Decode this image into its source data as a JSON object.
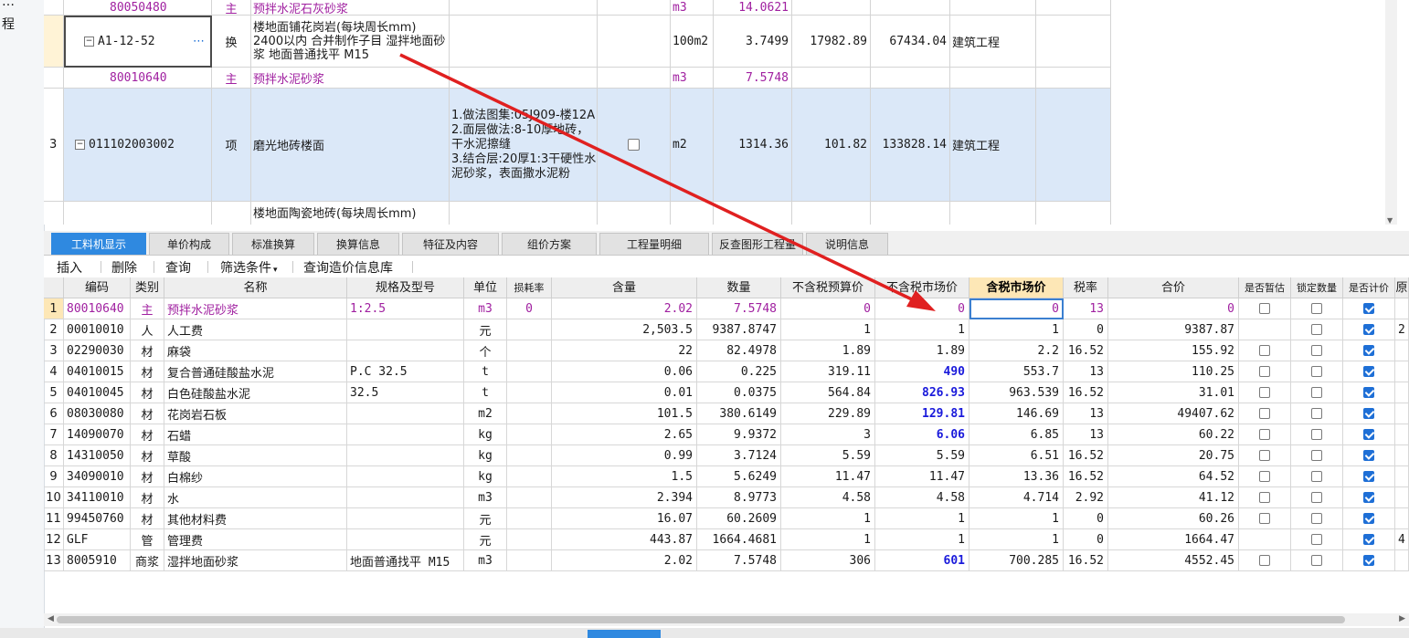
{
  "left_panel": {
    "items": [
      "…",
      "程"
    ]
  },
  "top_grid": {
    "rows": [
      {
        "no": "",
        "code": "80050480",
        "kind": "主",
        "name": "预拌水泥石灰砂浆",
        "desc": "",
        "unit": "m3",
        "qty": "14.0621",
        "price": "",
        "total": "",
        "type": ""
      },
      {
        "no": "",
        "code": "A1-12-52",
        "kind": "换",
        "name": "楼地面铺花岗岩(每块周长mm) 2400以内  合并制作子目 湿拌地面砂浆 地面普通找平 M15",
        "desc": "",
        "unit": "100m2",
        "qty": "3.7499",
        "price": "17982.89",
        "total": "67434.04",
        "type": "建筑工程"
      },
      {
        "no": "",
        "code": "80010640",
        "kind": "主",
        "name": "预拌水泥砂浆",
        "desc": "",
        "unit": "m3",
        "qty": "7.5748",
        "price": "",
        "total": "",
        "type": ""
      },
      {
        "no": "3",
        "code": "011102003002",
        "kind": "项",
        "name": "磨光地砖楼面",
        "desc": "1.做法图集:05J909-楼12A\n2.面层做法:8-10厚地砖，干水泥擦缝\n3.结合层:20厚1:3干硬性水泥砂浆，表面撒水泥粉",
        "unit": "m2",
        "qty": "1314.36",
        "price": "101.82",
        "total": "133828.14",
        "type": "建筑工程"
      },
      {
        "no": "",
        "code": "",
        "kind": "",
        "name": "楼地面陶瓷地砖(每块周长mm)",
        "desc": "",
        "unit": "",
        "qty": "",
        "price": "",
        "total": "",
        "type": ""
      }
    ]
  },
  "tabs": [
    "工料机显示",
    "单价构成",
    "标准换算",
    "换算信息",
    "特征及内容",
    "组价方案",
    "工程量明细",
    "反查图形工程量",
    "说明信息"
  ],
  "active_tab": 0,
  "toolbar": [
    "插入",
    "删除",
    "查询",
    "筛选条件",
    "查询造价信息库"
  ],
  "columns": [
    "编码",
    "类别",
    "名称",
    "规格及型号",
    "单位",
    "损耗率",
    "含量",
    "数量",
    "不含税预算价",
    "不含税市场价",
    "含税市场价",
    "税率",
    "合价",
    "是否暂估",
    "锁定数量",
    "是否计价",
    "原"
  ],
  "rows": [
    {
      "no": "1",
      "code": "80010640",
      "cat": "主",
      "name": "预拌水泥砂浆",
      "spec": "1:2.5",
      "unit": "m3",
      "loss": "0",
      "content": "2.02",
      "qty": "7.5748",
      "budget": "0",
      "market": "0",
      "tax_market": "0",
      "rate": "13",
      "total": "0",
      "est": false,
      "lock": false,
      "priced": true,
      "orig": ""
    },
    {
      "no": "2",
      "code": "00010010",
      "cat": "人",
      "name": "人工费",
      "spec": "",
      "unit": "元",
      "loss": "",
      "content": "2,503.5",
      "qty": "9387.8747",
      "budget": "1",
      "market": "1",
      "tax_market": "1",
      "rate": "0",
      "total": "9387.87",
      "est": null,
      "lock": false,
      "priced": true,
      "orig": "2"
    },
    {
      "no": "3",
      "code": "02290030",
      "cat": "材",
      "name": "麻袋",
      "spec": "",
      "unit": "个",
      "loss": "",
      "content": "22",
      "qty": "82.4978",
      "budget": "1.89",
      "market": "1.89",
      "tax_market": "2.2",
      "rate": "16.52",
      "total": "155.92",
      "est": false,
      "lock": false,
      "priced": true,
      "orig": ""
    },
    {
      "no": "4",
      "code": "04010015",
      "cat": "材",
      "name": "复合普通硅酸盐水泥",
      "spec": "P.C 32.5",
      "unit": "t",
      "loss": "",
      "content": "0.06",
      "qty": "0.225",
      "budget": "319.11",
      "market": "490",
      "tax_market": "553.7",
      "rate": "13",
      "total": "110.25",
      "est": false,
      "lock": false,
      "priced": true,
      "orig": ""
    },
    {
      "no": "5",
      "code": "04010045",
      "cat": "材",
      "name": "白色硅酸盐水泥",
      "spec": "32.5",
      "unit": "t",
      "loss": "",
      "content": "0.01",
      "qty": "0.0375",
      "budget": "564.84",
      "market": "826.93",
      "tax_market": "963.539",
      "rate": "16.52",
      "total": "31.01",
      "est": false,
      "lock": false,
      "priced": true,
      "orig": ""
    },
    {
      "no": "6",
      "code": "08030080",
      "cat": "材",
      "name": "花岗岩石板",
      "spec": "",
      "unit": "m2",
      "loss": "",
      "content": "101.5",
      "qty": "380.6149",
      "budget": "229.89",
      "market": "129.81",
      "tax_market": "146.69",
      "rate": "13",
      "total": "49407.62",
      "est": false,
      "lock": false,
      "priced": true,
      "orig": ""
    },
    {
      "no": "7",
      "code": "14090070",
      "cat": "材",
      "name": "石蜡",
      "spec": "",
      "unit": "kg",
      "loss": "",
      "content": "2.65",
      "qty": "9.9372",
      "budget": "3",
      "market": "6.06",
      "tax_market": "6.85",
      "rate": "13",
      "total": "60.22",
      "est": false,
      "lock": false,
      "priced": true,
      "orig": ""
    },
    {
      "no": "8",
      "code": "14310050",
      "cat": "材",
      "name": "草酸",
      "spec": "",
      "unit": "kg",
      "loss": "",
      "content": "0.99",
      "qty": "3.7124",
      "budget": "5.59",
      "market": "5.59",
      "tax_market": "6.51",
      "rate": "16.52",
      "total": "20.75",
      "est": false,
      "lock": false,
      "priced": true,
      "orig": ""
    },
    {
      "no": "9",
      "code": "34090010",
      "cat": "材",
      "name": "白棉纱",
      "spec": "",
      "unit": "kg",
      "loss": "",
      "content": "1.5",
      "qty": "5.6249",
      "budget": "11.47",
      "market": "11.47",
      "tax_market": "13.36",
      "rate": "16.52",
      "total": "64.52",
      "est": false,
      "lock": false,
      "priced": true,
      "orig": ""
    },
    {
      "no": "10",
      "code": "34110010",
      "cat": "材",
      "name": "水",
      "spec": "",
      "unit": "m3",
      "loss": "",
      "content": "2.394",
      "qty": "8.9773",
      "budget": "4.58",
      "market": "4.58",
      "tax_market": "4.714",
      "rate": "2.92",
      "total": "41.12",
      "est": false,
      "lock": false,
      "priced": true,
      "orig": ""
    },
    {
      "no": "11",
      "code": "99450760",
      "cat": "材",
      "name": "其他材料费",
      "spec": "",
      "unit": "元",
      "loss": "",
      "content": "16.07",
      "qty": "60.2609",
      "budget": "1",
      "market": "1",
      "tax_market": "1",
      "rate": "0",
      "total": "60.26",
      "est": false,
      "lock": false,
      "priced": true,
      "orig": ""
    },
    {
      "no": "12",
      "code": "GLF",
      "cat": "管",
      "name": "管理费",
      "spec": "",
      "unit": "元",
      "loss": "",
      "content": "443.87",
      "qty": "1664.4681",
      "budget": "1",
      "market": "1",
      "tax_market": "1",
      "rate": "0",
      "total": "1664.47",
      "est": null,
      "lock": false,
      "priced": true,
      "orig": "4"
    },
    {
      "no": "13",
      "code": "8005910",
      "cat": "商浆",
      "name": "湿拌地面砂浆",
      "spec": "地面普通找平 M15",
      "unit": "m3",
      "loss": "",
      "content": "2.02",
      "qty": "7.5748",
      "budget": "306",
      "market": "601",
      "tax_market": "700.285",
      "rate": "16.52",
      "total": "4552.45",
      "est": false,
      "lock": false,
      "priced": true,
      "orig": ""
    }
  ],
  "blue_market_rows": [
    3,
    4,
    5,
    6,
    12
  ],
  "colors": {
    "accent": "#2f89e0",
    "selection": "#dbe8f8",
    "annotation_arrow": "#e02020",
    "purple_text": "#a020a0",
    "blue_value": "#1a1adb"
  }
}
